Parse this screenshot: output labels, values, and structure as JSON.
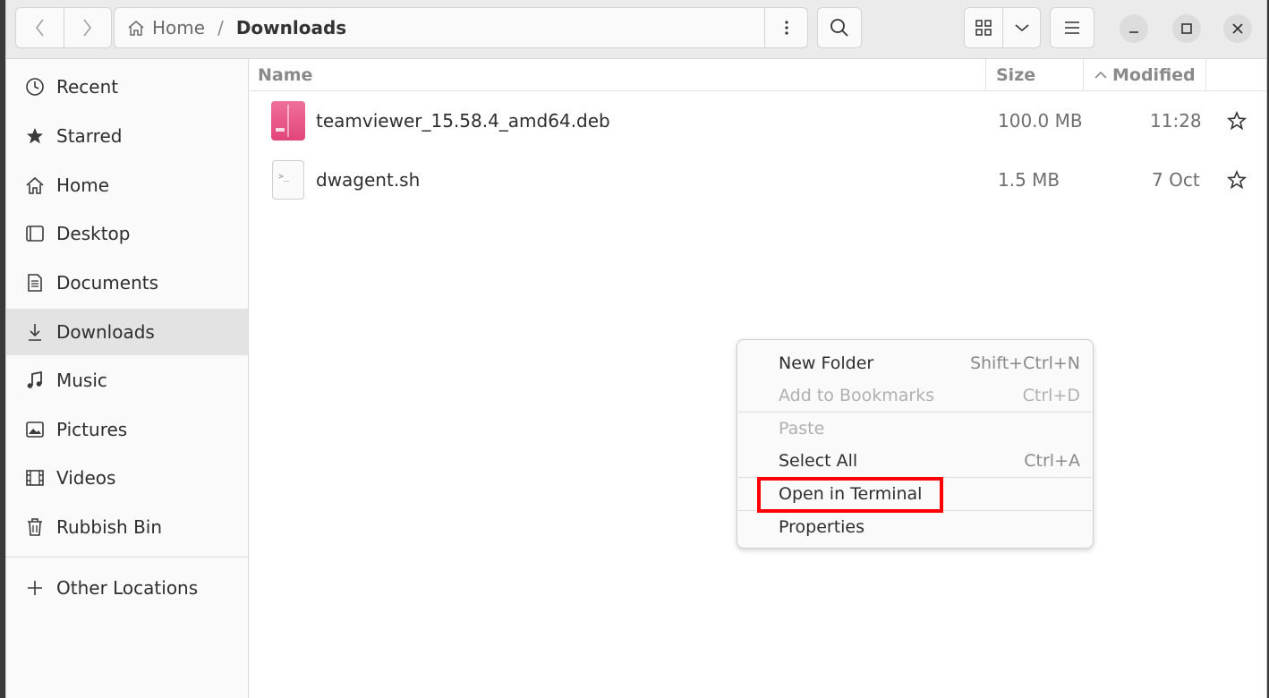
{
  "header": {
    "path_home": "Home",
    "path_separator": "/",
    "path_current": "Downloads",
    "icons": [
      "back-icon",
      "forward-icon",
      "home-icon",
      "kebab-menu-icon",
      "search-icon",
      "grid-view-icon",
      "chevron-down-icon",
      "hamburger-menu-icon",
      "minimize-icon",
      "maximize-icon",
      "close-icon"
    ]
  },
  "sidebar": {
    "items": [
      {
        "label": "Recent",
        "icon": "clock-icon"
      },
      {
        "label": "Starred",
        "icon": "star-icon"
      },
      {
        "label": "Home",
        "icon": "home-icon"
      },
      {
        "label": "Desktop",
        "icon": "desktop-icon"
      },
      {
        "label": "Documents",
        "icon": "document-icon"
      },
      {
        "label": "Downloads",
        "icon": "download-icon",
        "active": true
      },
      {
        "label": "Music",
        "icon": "music-icon"
      },
      {
        "label": "Pictures",
        "icon": "picture-icon"
      },
      {
        "label": "Videos",
        "icon": "video-icon"
      },
      {
        "label": "Rubbish Bin",
        "icon": "trash-icon"
      }
    ],
    "other_locations": "Other Locations"
  },
  "list": {
    "columns": {
      "name": "Name",
      "size": "Size",
      "modified": "Modified"
    },
    "files": [
      {
        "name": "teamviewer_15.58.4_amd64.deb",
        "size": "100.0 MB",
        "modified": "11:28"
      },
      {
        "name": "dwagent.sh",
        "size": "1.5 MB",
        "modified": "7 Oct"
      }
    ]
  },
  "context_menu": {
    "items": [
      {
        "label": "New Folder",
        "accel": "Shift+Ctrl+N",
        "disabled": false
      },
      {
        "label": "Add to Bookmarks",
        "accel": "Ctrl+D",
        "disabled": true
      },
      {
        "label": "Paste",
        "accel": "",
        "disabled": true
      },
      {
        "label": "Select All",
        "accel": "Ctrl+A",
        "disabled": false
      },
      {
        "label": "Open in Terminal",
        "accel": "",
        "disabled": false,
        "highlighted": true
      },
      {
        "label": "Properties",
        "accel": "",
        "disabled": false
      }
    ],
    "highlight_color": "#ff0000"
  }
}
